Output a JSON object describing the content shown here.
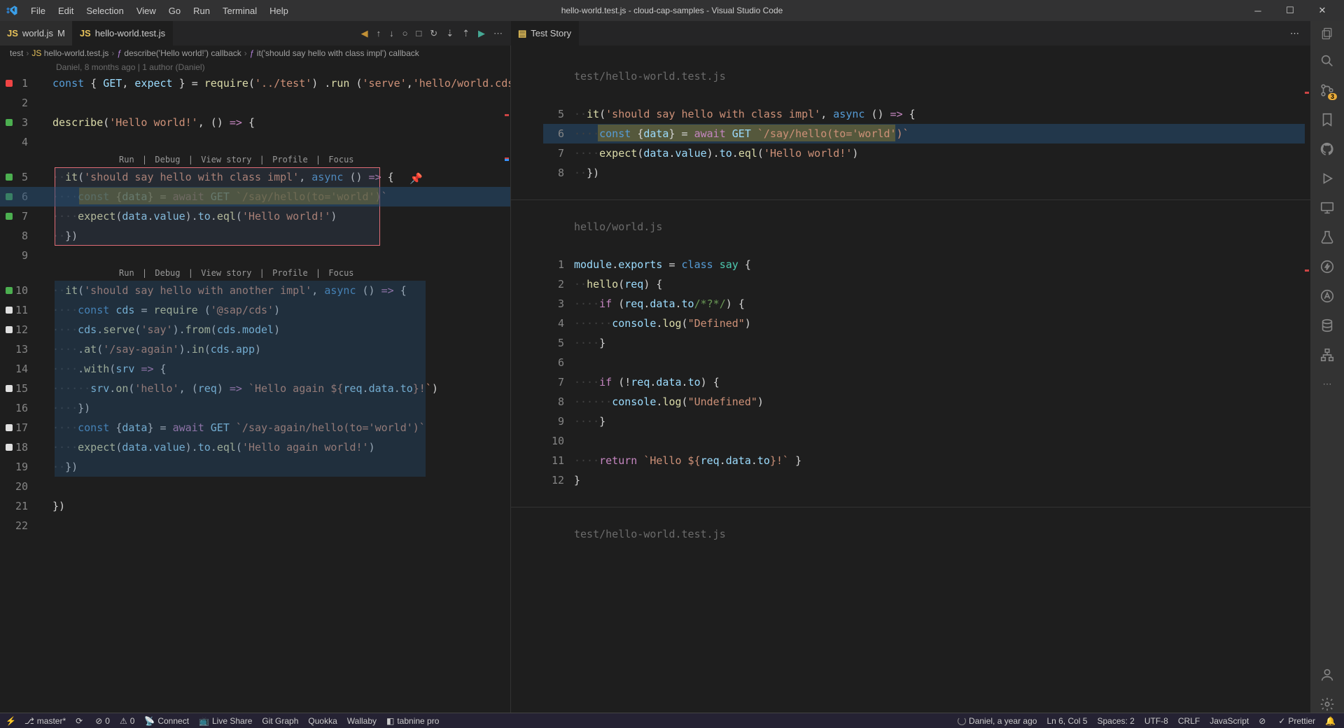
{
  "window": {
    "title": "hello-world.test.js - cloud-cap-samples - Visual Studio Code"
  },
  "menu": [
    "File",
    "Edit",
    "Selection",
    "View",
    "Go",
    "Run",
    "Terminal",
    "Help"
  ],
  "tabs": {
    "left": [
      {
        "icon": "JS",
        "name": "world.js",
        "modified": "M",
        "active": false
      },
      {
        "icon": "JS",
        "name": "hello-world.test.js",
        "modified": "",
        "active": true
      }
    ],
    "right": [
      {
        "icon": "▤",
        "name": "Test Story",
        "active": true
      }
    ]
  },
  "breadcrumbs": [
    {
      "label": "test",
      "icon": ""
    },
    {
      "label": "hello-world.test.js",
      "icon": "JS"
    },
    {
      "label": "describe('Hello world!') callback",
      "icon": "fn"
    },
    {
      "label": "it('should say hello with class impl') callback",
      "icon": "fn"
    }
  ],
  "gitlens": "Daniel, 8 months ago | 1 author (Daniel)",
  "codelens": {
    "items": [
      "Run",
      "Debug",
      "View story",
      "Profile",
      "Focus"
    ]
  },
  "left_code": [
    {
      "n": 1,
      "mark": "red",
      "html": "<span class='kw'>const</span> <span class='pun'>{</span> <span class='var'>GET</span><span class='pun'>,</span> <span class='var'>expect</span> <span class='pun'>}</span> <span class='pun'>=</span> <span class='fn'>require</span><span class='pun'>(</span><span class='str'>'../test'</span><span class='pun'>)</span> <span class='pun'>.</span><span class='fn'>run</span> <span class='pun'>(</span><span class='str'>'serve'</span><span class='pun'>,</span><span class='str'>'hello/world.cds'</span><span class='pun'>)</span>"
    },
    {
      "n": 2,
      "html": ""
    },
    {
      "n": 3,
      "mark": "green",
      "html": "<span class='fn'>describe</span><span class='pun'>(</span><span class='str'>'Hello world!'</span><span class='pun'>,</span> <span class='pun'>()</span> <span class='kw2'>=></span> <span class='pun'>{</span>"
    },
    {
      "n": 4,
      "html": ""
    },
    {
      "codelens": true
    },
    {
      "n": 5,
      "mark": "green",
      "html": "<span class='ind'>··</span><span class='fn'>it</span><span class='pun'>(</span><span class='str'>'should say hello with class impl'</span><span class='pun'>,</span> <span class='kw'>async</span> <span class='pun'>()</span> <span class='kw2'>=></span> <span class='pun'>{</span>",
      "pin": true
    },
    {
      "n": 6,
      "mark": "green",
      "html": "<span class='ind'>····</span><span class='kw'>const</span> <span class='pun'>{</span><span class='var'>data</span><span class='pun'>}</span> <span class='pun'>=</span> <span class='kw2'>await</span> <span class='var'>GET</span> <span class='str'>`/say/hello(to='world')`</span>"
    },
    {
      "n": 7,
      "mark": "green",
      "html": "<span class='ind'>····</span><span class='fn'>expect</span><span class='pun'>(</span><span class='var'>data</span><span class='pun'>.</span><span class='var'>value</span><span class='pun'>).</span><span class='var'>to</span><span class='pun'>.</span><span class='fn'>eql</span><span class='pun'>(</span><span class='str'>'Hello world!'</span><span class='pun'>)</span>"
    },
    {
      "n": 8,
      "html": "<span class='ind'>··</span><span class='pun'>})</span>"
    },
    {
      "n": 9,
      "html": ""
    },
    {
      "codelens": true
    },
    {
      "n": 10,
      "mark": "green",
      "html": "<span class='ind'>··</span><span class='fn'>it</span><span class='pun'>(</span><span class='str'>'should say hello with another impl'</span><span class='pun'>,</span> <span class='kw'>async</span> <span class='pun'>()</span> <span class='kw2'>=></span> <span class='pun'>{</span>"
    },
    {
      "n": 11,
      "mark": "white",
      "html": "<span class='ind'>····</span><span class='kw'>const</span> <span class='var'>cds</span> <span class='pun'>=</span> <span class='fn'>require</span> <span class='pun'>(</span><span class='str'>'@sap/cds'</span><span class='pun'>)</span>"
    },
    {
      "n": 12,
      "mark": "white",
      "html": "<span class='ind'>····</span><span class='var'>cds</span><span class='pun'>.</span><span class='fn'>serve</span><span class='pun'>(</span><span class='str'>'say'</span><span class='pun'>).</span><span class='fn'>from</span><span class='pun'>(</span><span class='var'>cds</span><span class='pun'>.</span><span class='var'>model</span><span class='pun'>)</span>"
    },
    {
      "n": 13,
      "html": "<span class='ind'>····</span><span class='pun'>.</span><span class='fn'>at</span><span class='pun'>(</span><span class='str'>'/say-again'</span><span class='pun'>).</span><span class='fn'>in</span><span class='pun'>(</span><span class='var'>cds</span><span class='pun'>.</span><span class='var'>app</span><span class='pun'>)</span>"
    },
    {
      "n": 14,
      "html": "<span class='ind'>····</span><span class='pun'>.</span><span class='fn'>with</span><span class='pun'>(</span><span class='var'>srv</span> <span class='kw2'>=></span> <span class='pun'>{</span>"
    },
    {
      "n": 15,
      "mark": "white",
      "html": "<span class='ind'>······</span><span class='var'>srv</span><span class='pun'>.</span><span class='fn'>on</span><span class='pun'>(</span><span class='str'>'hello'</span><span class='pun'>,</span> <span class='pun'>(</span><span class='var'>req</span><span class='pun'>)</span> <span class='kw2'>=></span> <span class='str'>`Hello again ${</span><span class='var'>req</span><span class='pun'>.</span><span class='var'>data</span><span class='pun'>.</span><span class='var'>to</span><span class='str'>}!`</span><span class='pun'>)</span>"
    },
    {
      "n": 16,
      "html": "<span class='ind'>····</span><span class='pun'>})</span>"
    },
    {
      "n": 17,
      "mark": "white",
      "html": "<span class='ind'>····</span><span class='kw'>const</span> <span class='pun'>{</span><span class='var'>data</span><span class='pun'>}</span> <span class='pun'>=</span> <span class='kw2'>await</span> <span class='var'>GET</span> <span class='str'>`/say-again/hello(to='world')`</span>"
    },
    {
      "n": 18,
      "mark": "white",
      "html": "<span class='ind'>····</span><span class='fn'>expect</span><span class='pun'>(</span><span class='var'>data</span><span class='pun'>.</span><span class='var'>value</span><span class='pun'>).</span><span class='var'>to</span><span class='pun'>.</span><span class='fn'>eql</span><span class='pun'>(</span><span class='str'>'Hello again world!'</span><span class='pun'>)</span>"
    },
    {
      "n": 19,
      "html": "<span class='ind'>··</span><span class='pun'>})</span>"
    },
    {
      "n": 20,
      "html": ""
    },
    {
      "n": 21,
      "html": "<span class='pun'>})</span>"
    },
    {
      "n": 22,
      "html": ""
    }
  ],
  "right_sections": [
    {
      "title": "test/hello-world.test.js",
      "lines": [
        {
          "n": 5,
          "html": "<span class='ind'>··</span><span class='fn'>it</span><span class='pun'>(</span><span class='str'>'should say hello with class impl'</span><span class='pun'>,</span> <span class='kw'>async</span> <span class='pun'>()</span> <span class='kw2'>=></span> <span class='pun'>{</span>"
        },
        {
          "n": 6,
          "hl": true,
          "html": "<span class='ind'>····</span><span class='kw'>const</span> <span class='pun'>{</span><span class='var'>data</span><span class='pun'>}</span> <span class='pun'>=</span> <span class='kw2'>await</span> <span class='var'>GET</span> <span class='str'>`/say/hello(to='world')`</span>"
        },
        {
          "n": 7,
          "html": "<span class='ind'>····</span><span class='fn'>expect</span><span class='pun'>(</span><span class='var'>data</span><span class='pun'>.</span><span class='var'>value</span><span class='pun'>).</span><span class='var'>to</span><span class='pun'>.</span><span class='fn'>eql</span><span class='pun'>(</span><span class='str'>'Hello world!'</span><span class='pun'>)</span>"
        },
        {
          "n": 8,
          "html": "<span class='ind'>··</span><span class='pun'>})</span>"
        }
      ]
    },
    {
      "title": "hello/world.js",
      "lines": [
        {
          "n": 1,
          "html": "<span class='var'>module</span><span class='pun'>.</span><span class='var'>exports</span> <span class='pun'>=</span> <span class='kw'>class</span> <span class='cls'>say</span> <span class='pun'>{</span>"
        },
        {
          "n": 2,
          "html": "<span class='ind'>··</span><span class='fn'>hello</span><span class='pun'>(</span><span class='var'>req</span><span class='pun'>)</span> <span class='pun'>{</span>"
        },
        {
          "n": 3,
          "html": "<span class='ind'>····</span><span class='kw2'>if</span> <span class='pun'>(</span><span class='var'>req</span><span class='pun'>.</span><span class='var'>data</span><span class='pun'>.</span><span class='var'>to</span><span class='cmt'>/*?*/</span><span class='pun'>)</span> <span class='pun'>{</span>"
        },
        {
          "n": 4,
          "html": "<span class='ind'>······</span><span class='var'>console</span><span class='pun'>.</span><span class='fn'>log</span><span class='pun'>(</span><span class='str'>\"Defined\"</span><span class='pun'>)</span>"
        },
        {
          "n": 5,
          "html": "<span class='ind'>····</span><span class='pun'>}</span>"
        },
        {
          "n": 6,
          "html": ""
        },
        {
          "n": 7,
          "html": "<span class='ind'>····</span><span class='kw2'>if</span> <span class='pun'>(!</span><span class='var'>req</span><span class='pun'>.</span><span class='var'>data</span><span class='pun'>.</span><span class='var'>to</span><span class='pun'>)</span> <span class='pun'>{</span>"
        },
        {
          "n": 8,
          "html": "<span class='ind'>······</span><span class='var'>console</span><span class='pun'>.</span><span class='fn'>log</span><span class='pun'>(</span><span class='str'>\"Undefined\"</span><span class='pun'>)</span>"
        },
        {
          "n": 9,
          "html": "<span class='ind'>····</span><span class='pun'>}</span>"
        },
        {
          "n": 10,
          "html": ""
        },
        {
          "n": 11,
          "html": "<span class='ind'>····</span><span class='kw2'>return</span> <span class='str'>`Hello ${</span><span class='var'>req</span><span class='pun'>.</span><span class='var'>data</span><span class='pun'>.</span><span class='var'>to</span><span class='str'>}!`</span> <span class='pun'>}</span>"
        },
        {
          "n": 12,
          "html": "<span class='pun'>}</span>"
        }
      ]
    },
    {
      "title": "test/hello-world.test.js",
      "lines": []
    }
  ],
  "statusbar": {
    "left": [
      {
        "icon": "⎇",
        "label": "master*"
      },
      {
        "icon": "⟳",
        "label": ""
      },
      {
        "icon": "⊘",
        "label": "0"
      },
      {
        "icon": "⚠",
        "label": "0"
      },
      {
        "icon": "📡",
        "label": "Connect"
      },
      {
        "icon": "📺",
        "label": "Live Share"
      },
      {
        "label": "Git Graph"
      },
      {
        "label": "Quokka"
      },
      {
        "label": "Wallaby"
      },
      {
        "icon": "◧",
        "label": "tabnine pro"
      }
    ],
    "right": [
      {
        "icon": "spin",
        "label": "Daniel, a year ago"
      },
      {
        "label": "Ln 6, Col 5"
      },
      {
        "label": "Spaces: 2"
      },
      {
        "label": "UTF-8"
      },
      {
        "label": "CRLF"
      },
      {
        "label": "JavaScript"
      },
      {
        "icon": "⊘",
        "label": ""
      },
      {
        "icon": "✓",
        "label": "Prettier"
      },
      {
        "icon": "🔔",
        "label": ""
      }
    ]
  },
  "sidebar_badge": "3"
}
